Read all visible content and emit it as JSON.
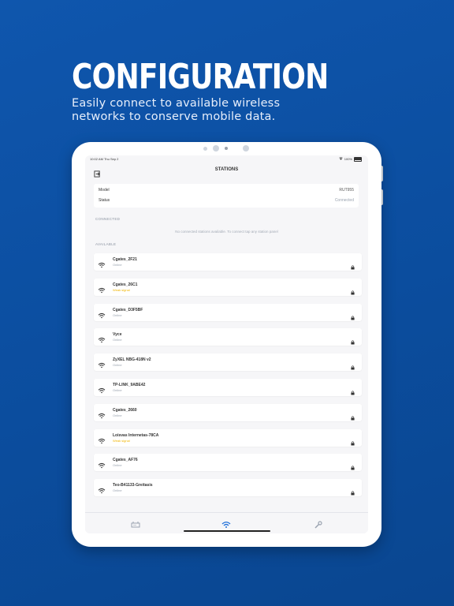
{
  "promo": {
    "headline": "CONFIGURATION",
    "subline": "Easily connect to available wireless networks to conserve mobile data."
  },
  "statusbar": {
    "time": "10:02 AM   Thu Sep 2",
    "battery": "100%"
  },
  "nav": {
    "title": "STATIONS"
  },
  "info": {
    "model_label": "Model",
    "model_value": "RUT955",
    "status_label": "Status",
    "status_value": "Connected"
  },
  "connected": {
    "header": "CONNECTED",
    "empty_text": "No connected stations available. To connect tap any station panel"
  },
  "available": {
    "header": "AVAILABLE",
    "items": [
      {
        "name": "Cgates_2F21",
        "state": "Online",
        "warn": false
      },
      {
        "name": "Cgates_26C1",
        "state": "Weak signal",
        "warn": true
      },
      {
        "name": "Cgates_D3F5BF",
        "state": "Online",
        "warn": false
      },
      {
        "name": "Vyce",
        "state": "Online",
        "warn": false
      },
      {
        "name": "ZyXEL NBG-418N v2",
        "state": "Online",
        "warn": false
      },
      {
        "name": "TP-LINK_9ABE42",
        "state": "Online",
        "warn": false
      },
      {
        "name": "Cgates_2660",
        "state": "Online",
        "warn": false
      },
      {
        "name": "Loisvas Internetas-78CA",
        "state": "Weak signal",
        "warn": true
      },
      {
        "name": "Cgates_AF76",
        "state": "Online",
        "warn": false
      },
      {
        "name": "Teo-B41133-Greitasis",
        "state": "Online",
        "warn": false
      }
    ]
  },
  "colors": {
    "accent": "#1e6fd9",
    "warn": "#f0b400",
    "background": "#0f56ad"
  },
  "icons": {
    "back": "exit-icon",
    "wifi": "wifi-icon",
    "lock": "lock-icon",
    "tab_devices": "router-icon",
    "tab_wireless": "wifi-icon",
    "tab_tools": "wrench-icon"
  }
}
